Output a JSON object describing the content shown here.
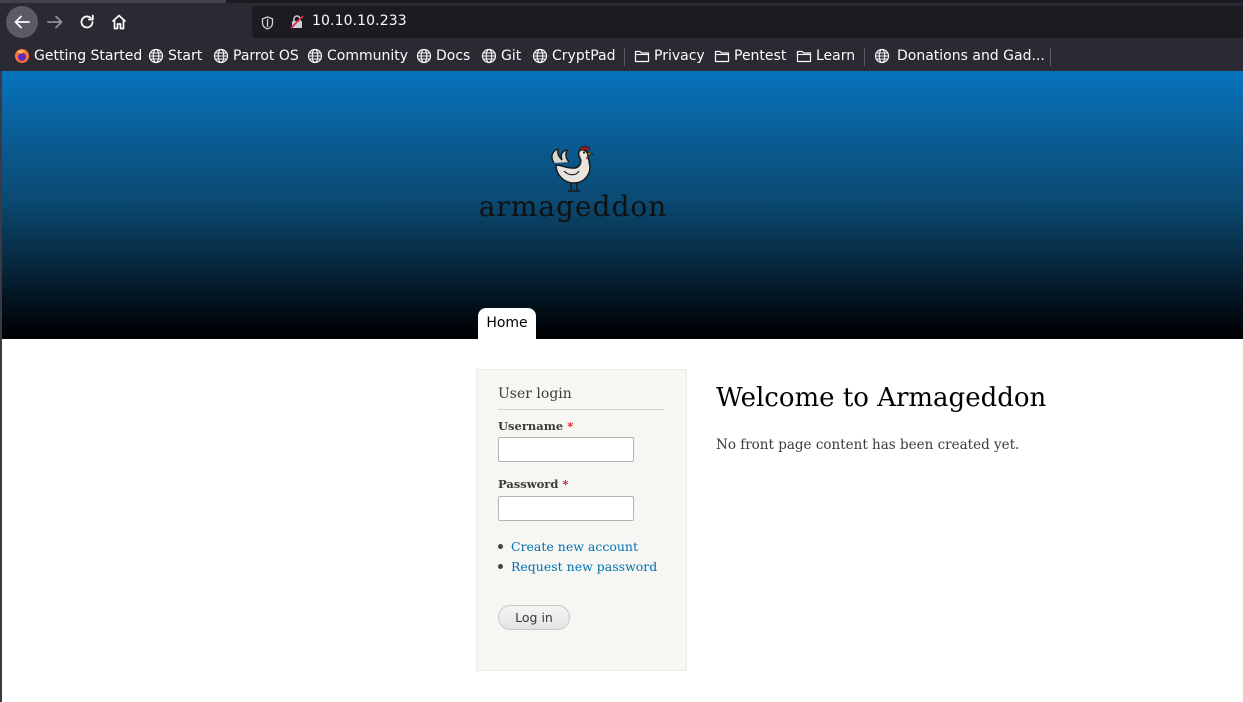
{
  "browser": {
    "url": "10.10.10.233",
    "nav_icons": [
      "back-arrow-icon",
      "forward-arrow-icon",
      "reload-icon",
      "home-icon"
    ],
    "bookmarks": [
      {
        "label": "Getting Started",
        "icon": "firefox-icon"
      },
      {
        "label": "Start",
        "icon": "globe-icon"
      },
      {
        "label": "Parrot OS",
        "icon": "globe-icon"
      },
      {
        "label": "Community",
        "icon": "globe-icon"
      },
      {
        "label": "Docs",
        "icon": "globe-icon"
      },
      {
        "label": "Git",
        "icon": "globe-icon"
      },
      {
        "label": "CryptPad",
        "icon": "globe-icon"
      },
      {
        "label": "Privacy",
        "icon": "folder-icon"
      },
      {
        "label": "Pentest",
        "icon": "folder-icon"
      },
      {
        "label": "Learn",
        "icon": "folder-icon"
      },
      {
        "label": "Donations and Gad...",
        "icon": "globe-icon"
      }
    ]
  },
  "site": {
    "name": "armageddon",
    "logo_icon": "rooster-icon",
    "nav": {
      "home": "Home"
    },
    "header_gradient": [
      "#0774bd",
      "#000000"
    ]
  },
  "login": {
    "title": "User login",
    "username_label": "Username",
    "password_label": "Password",
    "required_mark": "*",
    "links": {
      "create": "Create new account",
      "request": "Request new password"
    },
    "submit": "Log in"
  },
  "main": {
    "title": "Welcome to Armageddon",
    "text": "No front page content has been created yet."
  },
  "colors": {
    "link": "#0071b3",
    "required": "#e0151a",
    "chrome": "#2b2a33"
  }
}
